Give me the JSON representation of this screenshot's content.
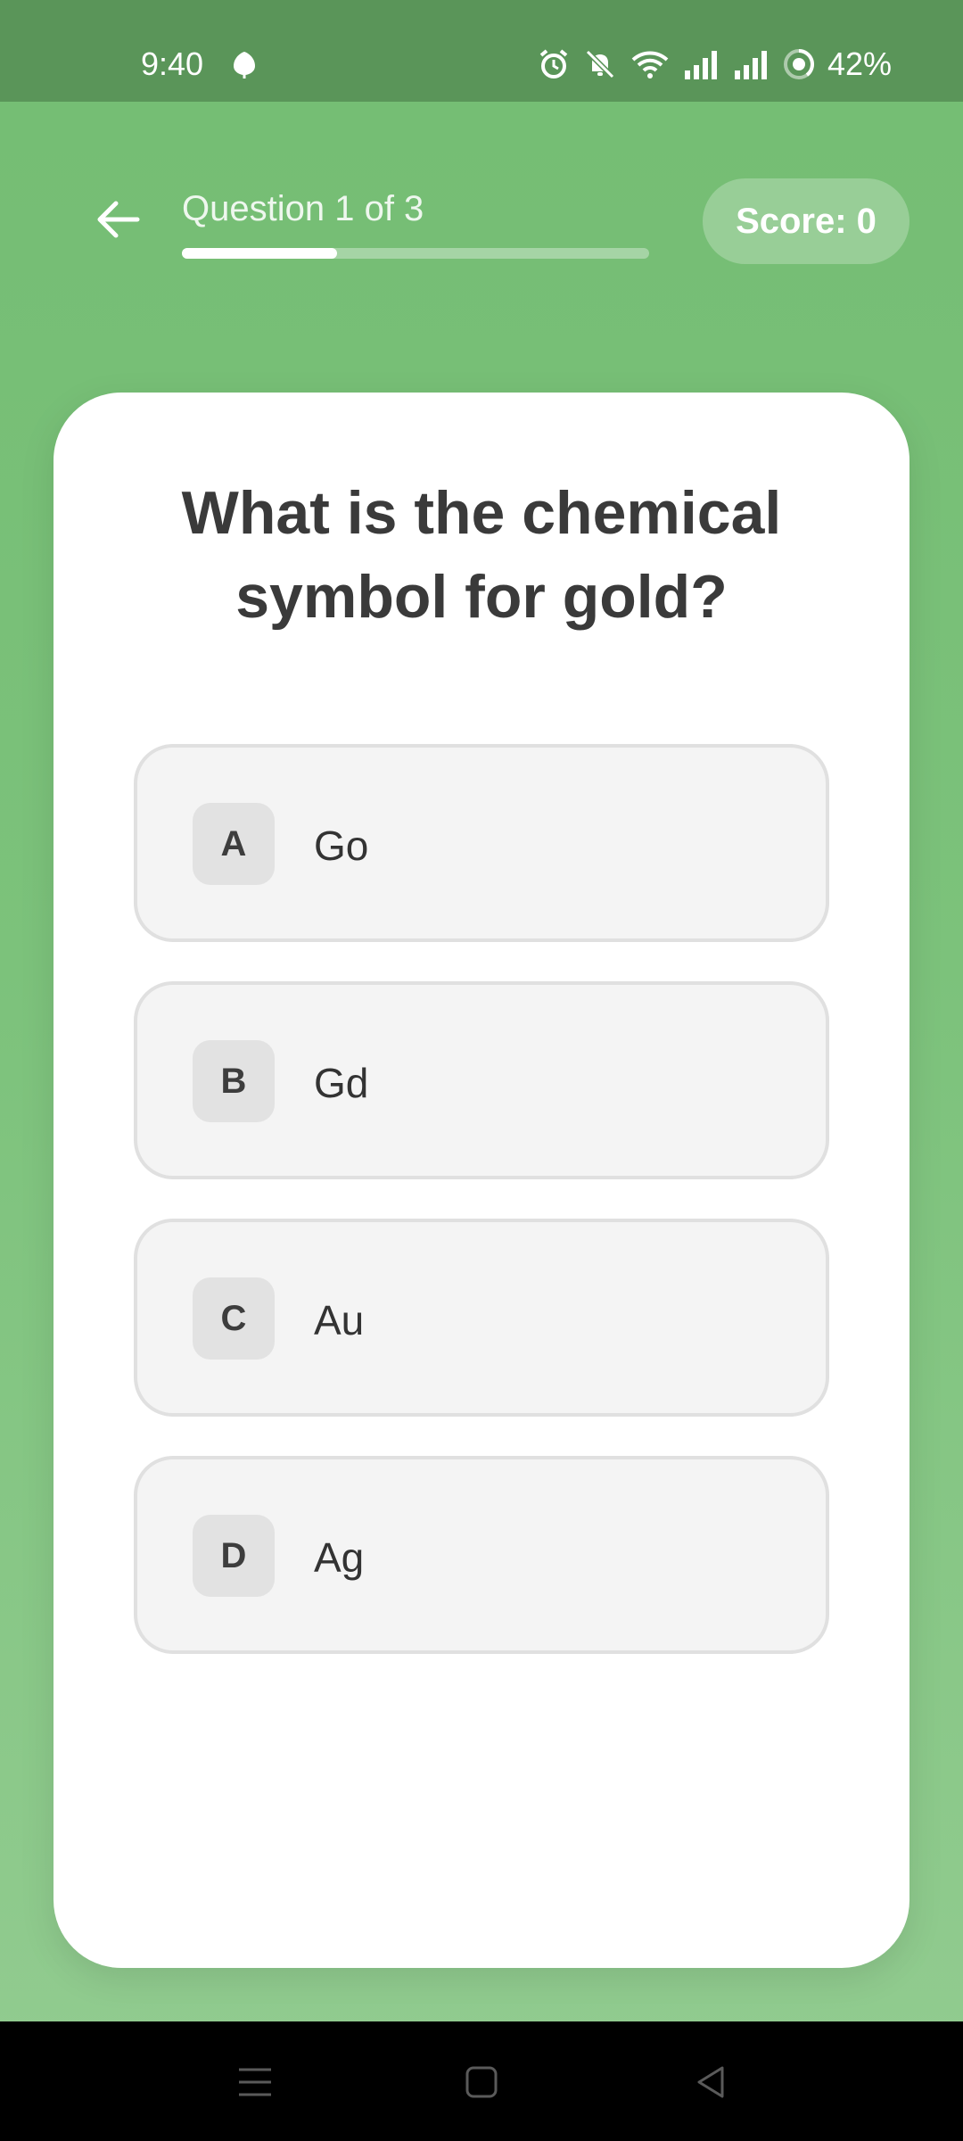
{
  "status_bar": {
    "time": "9:40",
    "battery": "42%",
    "icons": [
      "leaf-icon",
      "alarm-icon",
      "bell-off-icon",
      "wifi-icon",
      "signal-icon",
      "signal-icon",
      "battery-icon"
    ]
  },
  "header": {
    "back_icon": "arrow-left-icon",
    "progress_label": "Question 1 of 3",
    "progress_fraction": 0.333,
    "score_label": "Score: 0"
  },
  "question": {
    "text": "What is the chemical symbol for gold?"
  },
  "options": [
    {
      "letter": "A",
      "text": "Go"
    },
    {
      "letter": "B",
      "text": "Gd"
    },
    {
      "letter": "C",
      "text": "Au"
    },
    {
      "letter": "D",
      "text": "Ag"
    }
  ],
  "nav_bar": {
    "icons": [
      "menu-icon",
      "home-icon",
      "back-triangle-icon"
    ]
  },
  "colors": {
    "background": "#7cc27b",
    "status_bar": "#5a9559",
    "card": "#ffffff",
    "option_bg": "#f4f4f4",
    "text": "#3a3a3a"
  }
}
